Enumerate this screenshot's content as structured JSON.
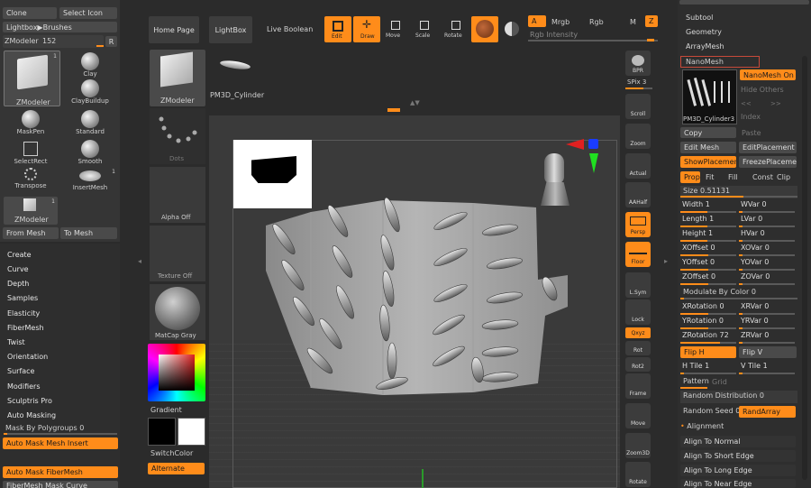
{
  "colors": {
    "accent": "#ff8c1a",
    "panel": "#353535",
    "bg": "#2b2b2b",
    "canvas": "#3a3a3a"
  },
  "left_panel": {
    "top_buttons": [
      "Clone",
      "Select Icon"
    ],
    "lightbox_brushes": "Lightbox▶Brushes",
    "zmodeler_label": "ZModeler",
    "zmodeler_value": "152",
    "r_label": "R",
    "brushes": [
      {
        "name": "ZModeler",
        "icon": "cube-icon",
        "count": "1"
      },
      {
        "name": "Clay",
        "icon": "sphere-icon"
      },
      {
        "name": "ClayBuildup",
        "icon": "sphere-icon"
      },
      {
        "name": "MaskPen",
        "icon": "sphere-icon"
      },
      {
        "name": "Standard",
        "icon": "sphere-icon"
      },
      {
        "name": "SelectRect",
        "icon": "select-rect-icon"
      },
      {
        "name": "Smooth",
        "icon": "sphere-icon"
      },
      {
        "name": "Transpose",
        "icon": "transpose-icon"
      },
      {
        "name": "InsertMesh",
        "icon": "insert-mesh-icon",
        "count": "1"
      },
      {
        "name": "ZModeler",
        "icon": "cube-icon",
        "count": "1"
      }
    ],
    "from_mesh": "From Mesh",
    "to_mesh": "To Mesh",
    "menu": [
      "Create",
      "Curve",
      "Depth",
      "Samples",
      "Elasticity",
      "FiberMesh",
      "Twist",
      "Orientation",
      "Surface",
      "Modifiers",
      "Sculptris Pro",
      "Auto Masking"
    ],
    "mask_by_polygroups": "Mask By Polygroups 0",
    "auto_mask_mesh_insert": "Auto Mask Mesh Insert",
    "auto_mask_fibermesh": "Auto Mask FiberMesh",
    "fibermesh_curve": "FiberMesh Mask Curve"
  },
  "second_column": {
    "tool_label": "ZModeler",
    "dots_label": "Dots",
    "alpha_label": "Alpha Off",
    "texture_label": "Texture Off",
    "matcap_label": "MatCap Gray",
    "gradient_label": "Gradient",
    "switchcolor_label": "SwitchColor",
    "alternate_label": "Alternate",
    "pm3d_label": "PM3D_Cylinder"
  },
  "top_toolbar": {
    "home_page": "Home Page",
    "lightbox": "LightBox",
    "live_boolean": "Live Boolean",
    "edit": "Edit",
    "draw": "Draw",
    "move": "Move",
    "scale": "Scale",
    "rotate": "Rotate",
    "a": "A",
    "mrgb": "Mrgb",
    "rgb": "Rgb",
    "m": "M",
    "z": "Z",
    "rgb_intensity": "Rgb Intensity"
  },
  "right_toolbar": [
    "BPR",
    "SPix 3",
    "Scroll",
    "Zoom",
    "Actual",
    "AAHalf",
    "Persp",
    "Floor",
    "L.Sym",
    "Lock",
    "Qxyz",
    "Rot",
    "Rot2",
    "Frame",
    "Move",
    "Zoom3D",
    "Rotate"
  ],
  "right_panel": {
    "top_items": [
      "Subtool",
      "Geometry",
      "ArrayMesh"
    ],
    "nanomesh_title": "NanoMesh",
    "nanomesh_on": "NanoMesh On",
    "hide_others": "Hide Others",
    "index_label": "Index",
    "thumb_label": "PM3D_Cylinder3",
    "copy": "Copy",
    "paste": "Paste",
    "edit_mesh": "Edit Mesh",
    "edit_placement": "EditPlacement",
    "show_placement": "ShowPlacement",
    "freeze_placement": "FreezePlacemen",
    "prop": "Prop",
    "fit": "Fit",
    "fill": "Fill",
    "const": "Const",
    "clip": "Clip",
    "size": "Size 0.51131",
    "props": [
      [
        "Width 1",
        "WVar 0"
      ],
      [
        "Length 1",
        "LVar 0"
      ],
      [
        "Height 1",
        "HVar 0"
      ],
      [
        "XOffset 0",
        "XOVar 0"
      ],
      [
        "YOffset 0",
        "YOVar 0"
      ],
      [
        "ZOffset 0",
        "ZOVar 0"
      ]
    ],
    "modulate": "Modulate By Color 0",
    "rotations": [
      [
        "XRotation 0",
        "XRVar 0"
      ],
      [
        "YRotation 0",
        "YRVar 0"
      ],
      [
        "ZRotation 72",
        "ZRVar 0"
      ]
    ],
    "flip_h": "Flip H",
    "flip_v": "Flip V",
    "h_tile": "H Tile 1",
    "v_tile": "V Tile 1",
    "pattern": "Pattern",
    "grid": "Grid",
    "random_distribution": "Random Distribution 0",
    "random_seed": "Random Seed 0",
    "rand_array": "RandArray",
    "alignment": "Alignment",
    "align_items": [
      "Align To Normal",
      "Align To Short Edge",
      "Align To Long Edge",
      "Align To Near Edge"
    ]
  }
}
